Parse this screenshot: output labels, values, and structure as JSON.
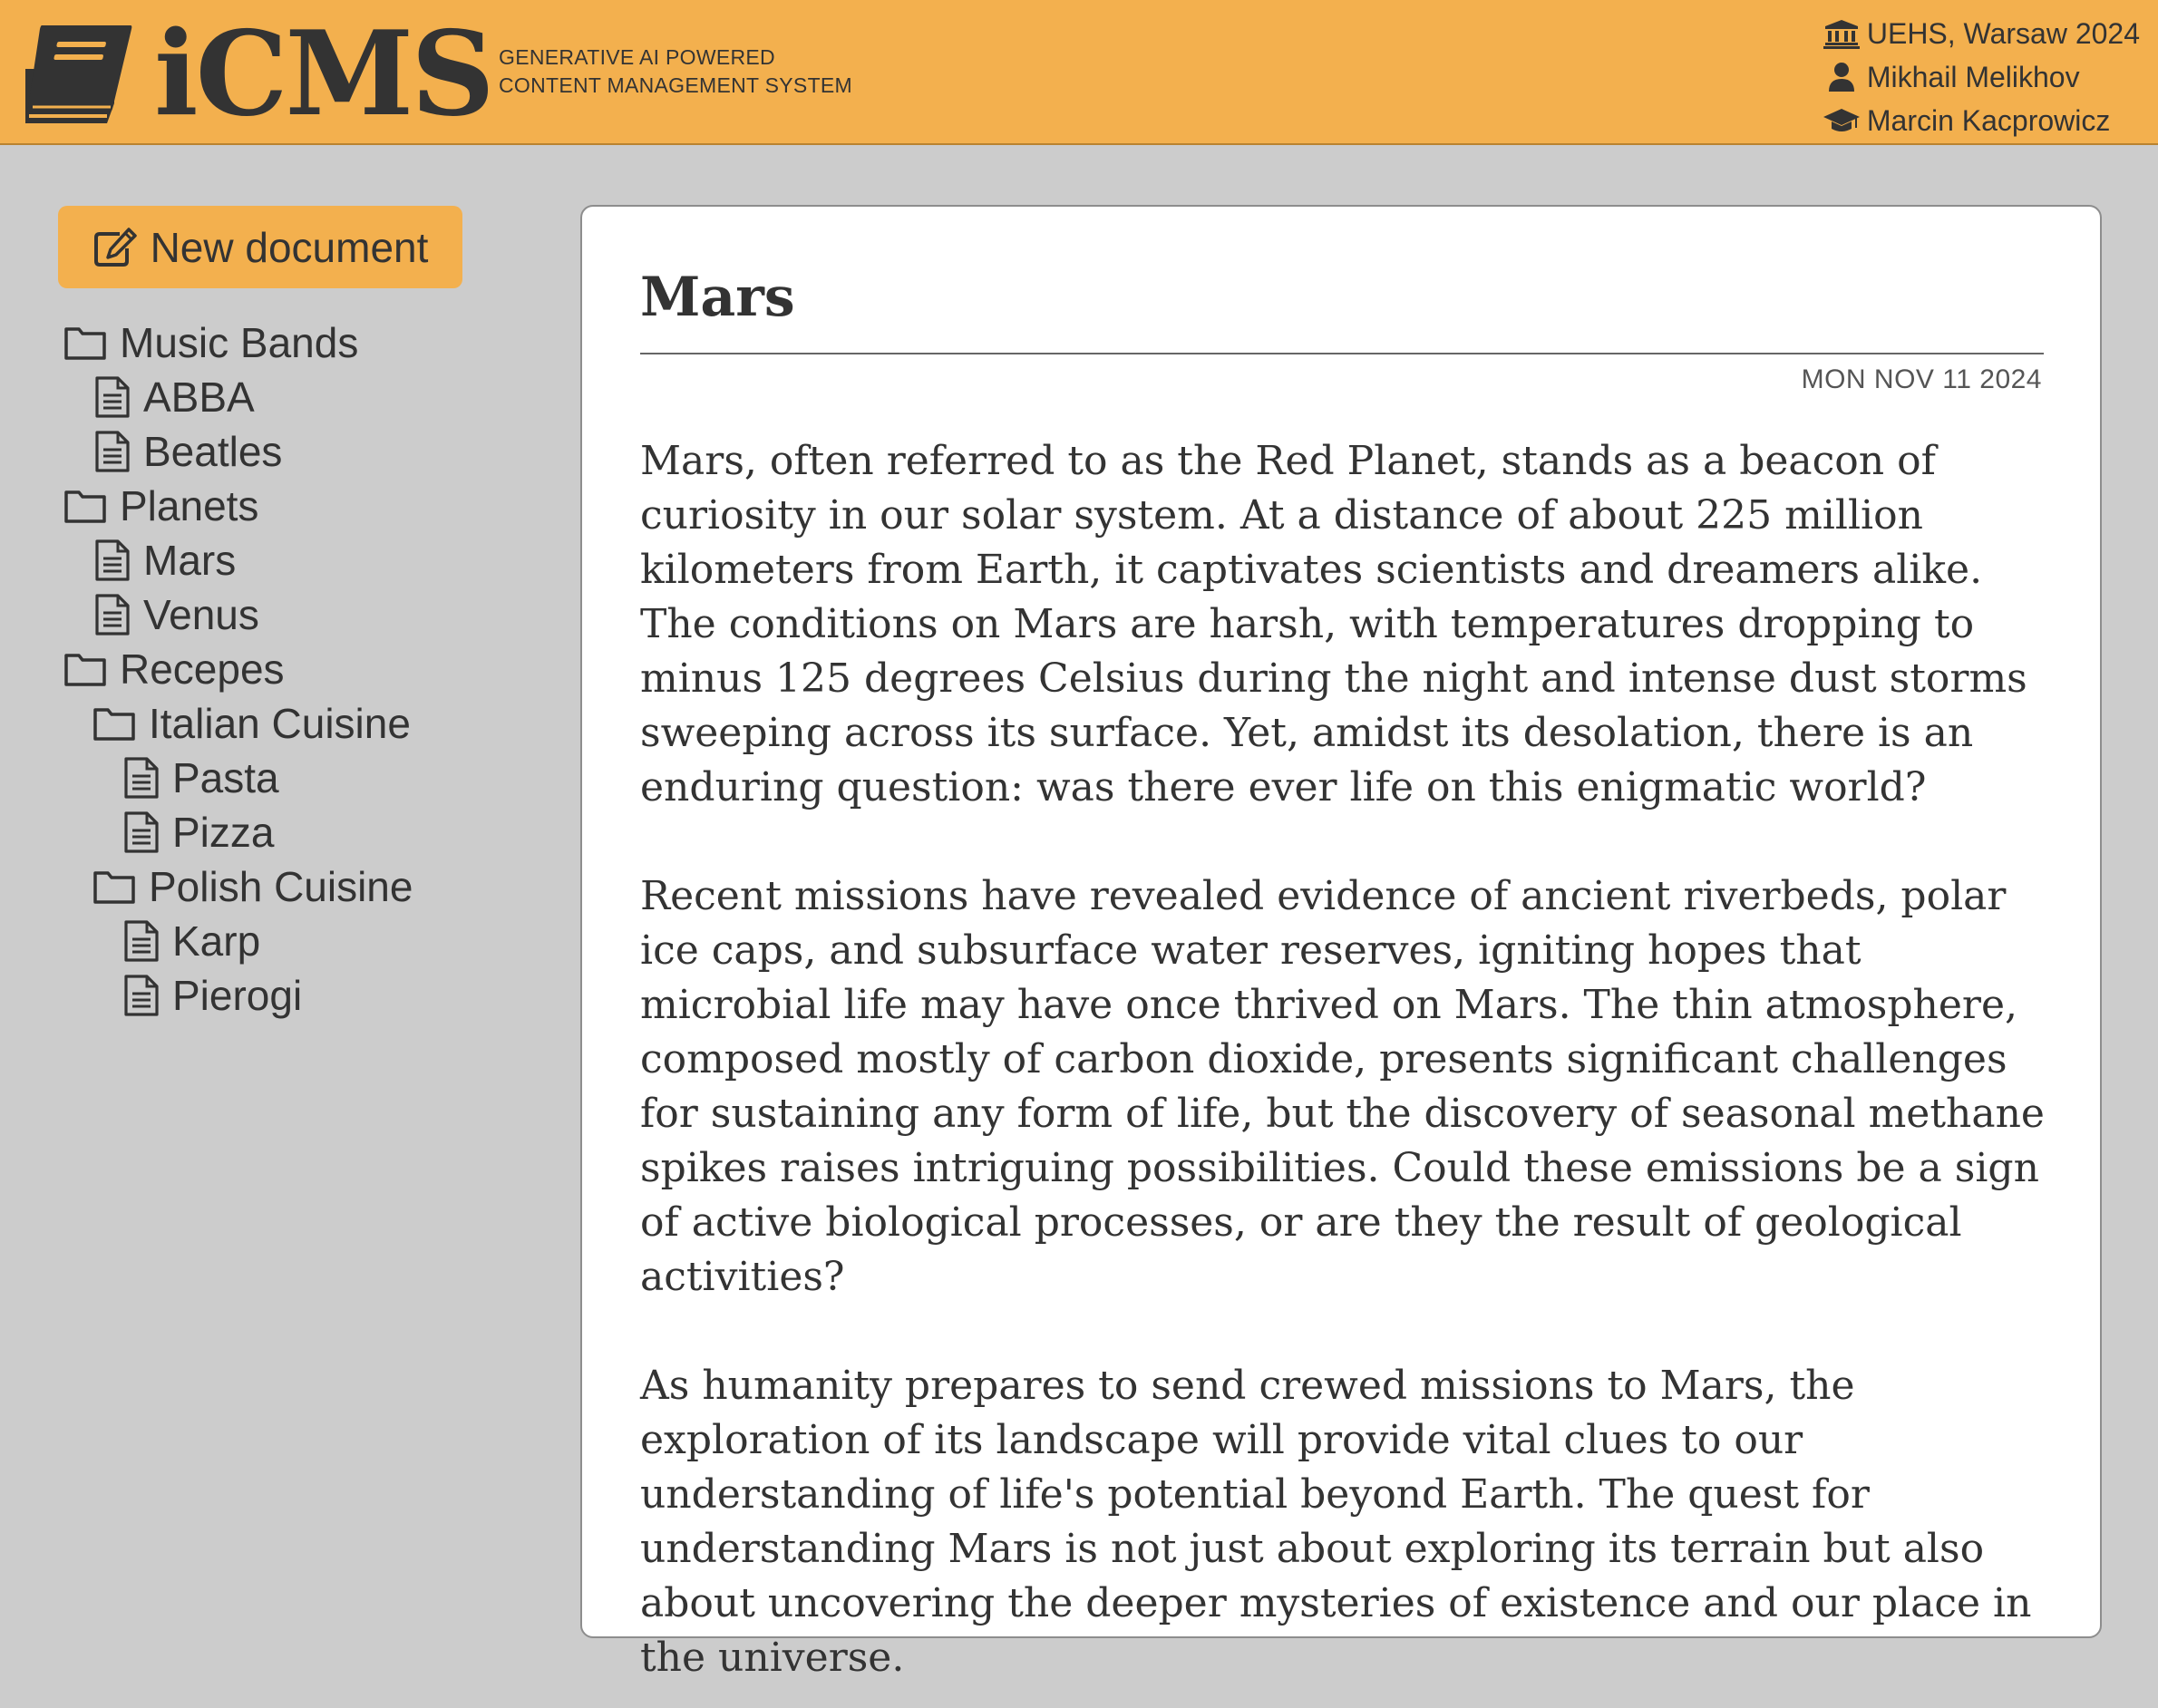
{
  "header": {
    "logo_text": "iCMS",
    "tagline_line1": "GENERATIVE AI POWERED",
    "tagline_line2": "CONTENT MANAGEMENT SYSTEM",
    "meta": [
      {
        "icon": "institution-icon",
        "text": "UEHS, Warsaw 2024"
      },
      {
        "icon": "user-icon",
        "text": "Mikhail Melikhov"
      },
      {
        "icon": "graduation-cap-icon",
        "text": "Marcin Kacprowicz"
      }
    ]
  },
  "sidebar": {
    "new_document_label": "New document",
    "tree": {
      "music_bands": "Music Bands",
      "abba": "ABBA",
      "beatles": "Beatles",
      "planets": "Planets",
      "mars": "Mars",
      "venus": "Venus",
      "recepes": "Recepes",
      "italian_cuisine": "Italian Cuisine",
      "pasta": "Pasta",
      "pizza": "Pizza",
      "polish_cuisine": "Polish Cuisine",
      "karp": "Karp",
      "pierogi": "Pierogi"
    }
  },
  "document": {
    "title": "Mars",
    "date": "MON NOV 11 2024",
    "paragraphs": [
      "Mars, often referred to as the Red Planet, stands as a beacon of curiosity in our solar system. At a distance of about 225 million kilometers from Earth, it captivates scientists and dreamers alike. The conditions on Mars are harsh, with temperatures dropping to minus 125 degrees Celsius during the night and intense dust storms sweeping across its surface. Yet, amidst its desolation, there is an enduring question: was there ever life on this enigmatic world?",
      "Recent missions have revealed evidence of ancient riverbeds, polar ice caps, and subsurface water reserves, igniting hopes that microbial life may have once thrived on Mars. The thin atmosphere, composed mostly of carbon dioxide, presents significant challenges for sustaining any form of life, but the discovery of seasonal methane spikes raises intriguing possibilities. Could these emissions be a sign of active biological processes, or are they the result of geological activities?",
      "As humanity prepares to send crewed missions to Mars, the exploration of its landscape will provide vital clues to our understanding of life's potential beyond Earth. The quest for understanding Mars is not just about exploring its terrain but also about uncovering the deeper mysteries of existence and our place in the universe."
    ]
  },
  "colors": {
    "accent": "#f3b04e",
    "background": "#cccccc",
    "text": "#333333",
    "card": "#ffffff"
  }
}
